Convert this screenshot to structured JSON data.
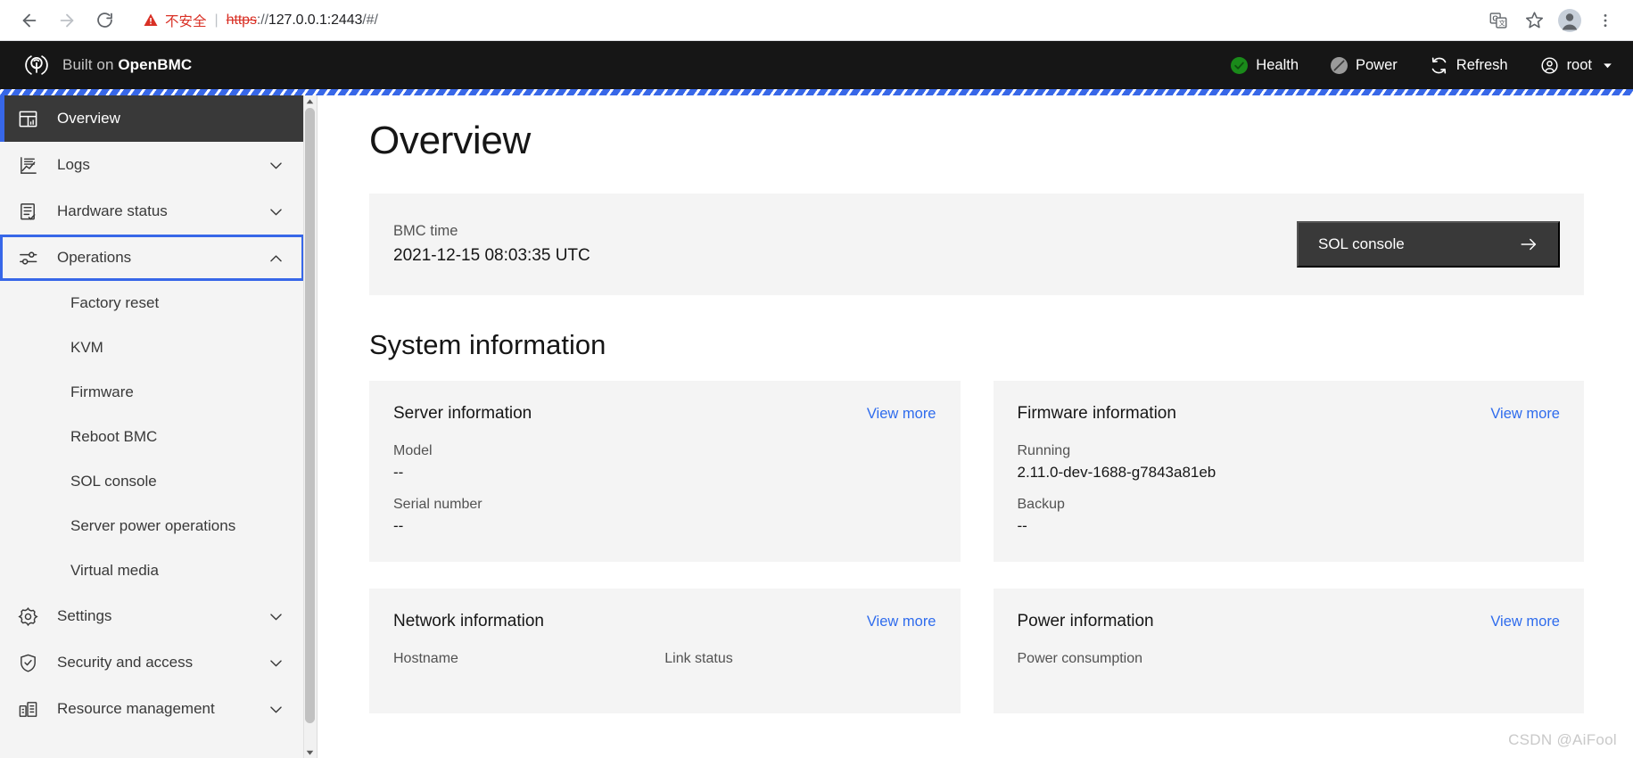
{
  "browser": {
    "back_icon": "arrow-left-icon",
    "forward_icon": "arrow-right-icon",
    "reload_icon": "reload-icon",
    "security_warning": "不安全",
    "url_scheme": "https",
    "url_separator": "://",
    "url_host": "127.0.0.1:2443",
    "url_path": "/#/",
    "translate_icon": "translate-icon",
    "bookmark_icon": "star-icon",
    "profile_icon": "profile-avatar-icon",
    "menu_icon": "three-dot-menu-icon"
  },
  "header": {
    "logo_icon": "openbmc-logo-icon",
    "brand_prefix": "Built on",
    "brand_name": "OpenBMC",
    "health_label": "Health",
    "health_status": "ok",
    "power_label": "Power",
    "power_status": "off",
    "refresh_label": "Refresh",
    "user_label": "root"
  },
  "sidebar": {
    "items": [
      {
        "label": "Overview",
        "icon": "dashboard-icon",
        "active": true,
        "expandable": false
      },
      {
        "label": "Logs",
        "icon": "logs-chart-icon",
        "active": false,
        "expandable": true,
        "expanded": false
      },
      {
        "label": "Hardware status",
        "icon": "server-check-icon",
        "active": false,
        "expandable": true,
        "expanded": false
      },
      {
        "label": "Operations",
        "icon": "sliders-icon",
        "active": false,
        "expandable": true,
        "expanded": true,
        "focused": true
      },
      {
        "label": "Settings",
        "icon": "gear-icon",
        "active": false,
        "expandable": true,
        "expanded": false
      },
      {
        "label": "Security and access",
        "icon": "shield-check-icon",
        "active": false,
        "expandable": true,
        "expanded": false
      },
      {
        "label": "Resource management",
        "icon": "resource-chart-icon",
        "active": false,
        "expandable": true,
        "expanded": false
      }
    ],
    "operations_subitems": [
      {
        "label": "Factory reset"
      },
      {
        "label": "KVM"
      },
      {
        "label": "Firmware"
      },
      {
        "label": "Reboot BMC"
      },
      {
        "label": "SOL console"
      },
      {
        "label": "Server power operations"
      },
      {
        "label": "Virtual media"
      }
    ]
  },
  "main": {
    "page_title": "Overview",
    "bmc_time_label": "BMC time",
    "bmc_time_value": "2021-12-15 08:03:35 UTC",
    "sol_console_button": "SOL console",
    "sol_console_arrow": "arrow-right-icon",
    "section_title": "System information",
    "view_more_label": "View more",
    "cards": [
      {
        "title": "Server information",
        "fields": [
          {
            "label": "Model",
            "value": "--"
          },
          {
            "label": "Serial number",
            "value": "--"
          }
        ]
      },
      {
        "title": "Firmware information",
        "fields": [
          {
            "label": "Running",
            "value": "2.11.0-dev-1688-g7843a81eb"
          },
          {
            "label": "Backup",
            "value": "--"
          }
        ]
      },
      {
        "title": "Network information",
        "fields": [
          {
            "label": "Hostname",
            "value": ""
          },
          {
            "label": "Link status",
            "value": ""
          }
        ]
      },
      {
        "title": "Power information",
        "fields": [
          {
            "label": "Power consumption",
            "value": ""
          }
        ]
      }
    ]
  },
  "watermark": "CSDN @AiFool",
  "colors": {
    "accent_blue": "#3767e8",
    "link_blue": "#2f6ced",
    "header_dark": "#161616",
    "active_nav": "#393939",
    "card_bg": "#f4f4f4",
    "health_green": "#1a8a1a",
    "power_gray": "#9a9a9a",
    "warning_red": "#d93025"
  }
}
